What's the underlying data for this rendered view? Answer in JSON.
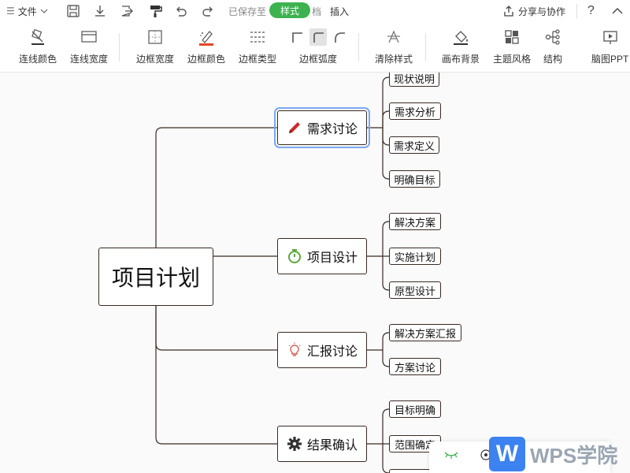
{
  "menubar": {
    "hamburger": "☰",
    "file": "文件",
    "saved": "已保存至",
    "saved_tail": "档",
    "style_tab": "样式",
    "insert_tab": "插入",
    "share": "分享与协作",
    "help": "?",
    "collapse": "^"
  },
  "toolbar": {
    "items": [
      {
        "label": "连线颜色"
      },
      {
        "label": "连线宽度"
      },
      {
        "label": "边框宽度"
      },
      {
        "label": "边框颜色"
      },
      {
        "label": "边框类型"
      },
      {
        "label": "边框弧度"
      },
      {
        "label": "清除样式"
      },
      {
        "label": "画布背景"
      },
      {
        "label": "主题风格"
      },
      {
        "label": "结构"
      },
      {
        "label": "脑图PPT"
      }
    ],
    "accent": "#e2482a"
  },
  "mindmap": {
    "root": "项目计划",
    "branches": [
      {
        "label": "需求讨论",
        "icon": "pencil-icon",
        "icon_color": "#c92a2a",
        "children": [
          "现状说明",
          "需求分析",
          "需求定义",
          "明确目标"
        ]
      },
      {
        "label": "项目设计",
        "icon": "stopwatch-icon",
        "icon_color": "#5aa83c",
        "children": [
          "解决方案",
          "实施计划",
          "原型设计"
        ]
      },
      {
        "label": "汇报讨论",
        "icon": "lightbulb-icon",
        "icon_color": "#d9564a",
        "children": [
          "解决方案汇报",
          "方案讨论"
        ]
      },
      {
        "label": "结果确认",
        "icon": "gear-icon",
        "icon_color": "#333333",
        "children": [
          "目标明确",
          "范围确定"
        ]
      }
    ],
    "line_color": "#3a2a22",
    "select_color": "#7aa9f0"
  },
  "watermark": {
    "text": "WPS学院",
    "logo": "W",
    "brand_color": "#3c82f0"
  }
}
